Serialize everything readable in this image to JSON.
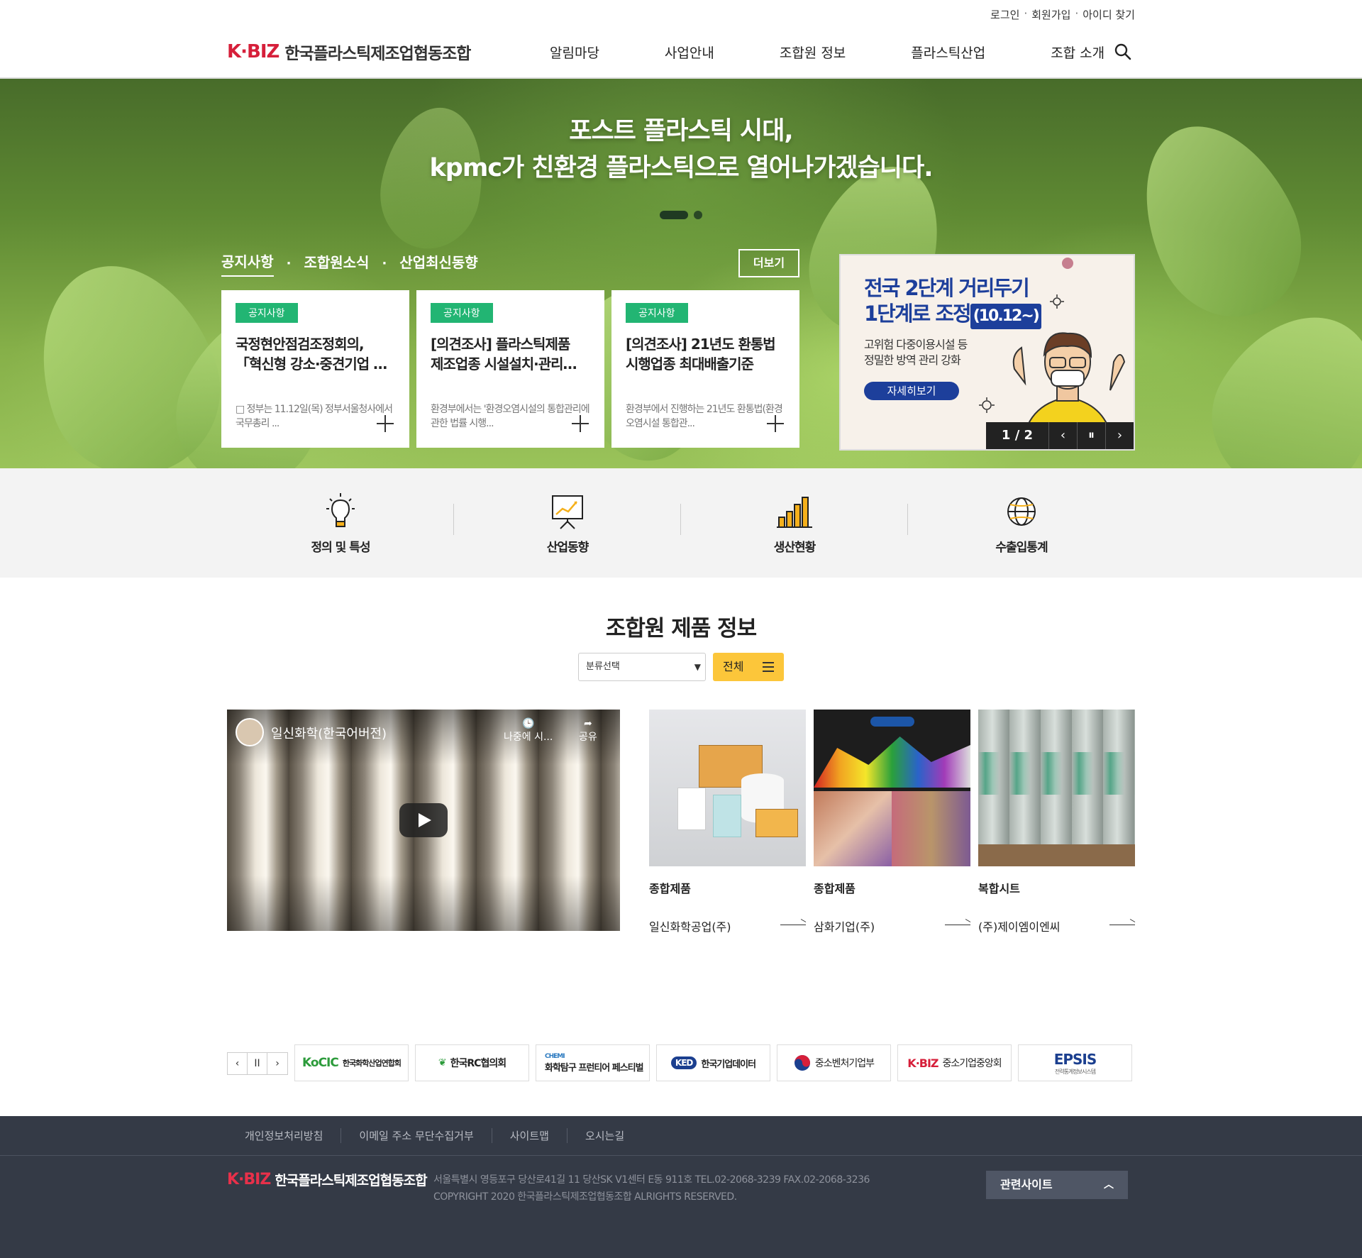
{
  "util": {
    "login": "로그인",
    "join": "회원가입",
    "find_id": "아이디 찾기",
    "sep": "·"
  },
  "header": {
    "logo_mark": "K·BIZ",
    "logo_name": "한국플라스틱제조업협동조합",
    "nav": [
      "알림마당",
      "사업안내",
      "조합원 정보",
      "플라스틱산업",
      "조합 소개"
    ],
    "search_icon": "search-icon"
  },
  "hero": {
    "title_line1": "포스트 플라스틱 시대,",
    "title_line2": "kpmc가 친환경 플라스틱으로 열어나가겠습니다.",
    "tabs": [
      "공지사항",
      "조합원소식",
      "산업최신동향"
    ],
    "tab_sep": "·",
    "more_label": "더보기",
    "cards": [
      {
        "badge": "공지사항",
        "title1": "국정현안점검조정회의,",
        "title2": "「혁신형 강소·중견기업 …",
        "desc": "□ 정부는 11.12일(목) 정부서울청사에서 국무총리 ..."
      },
      {
        "badge": "공지사항",
        "title1": "[의견조사] 플라스틱제품",
        "title2": "제조업종 시설설치·관리…",
        "desc": "환경부에서는 '환경오염시설의 통합관리에 관한 법률 시행..."
      },
      {
        "badge": "공지사항",
        "title1": "[의견조사] 21년도 환통법",
        "title2": "시행업종 최대배출기준",
        "desc": "환경부에서 진행하는 21년도 환통법(환경오염시설 통합관..."
      }
    ],
    "banner": {
      "title1": "전국 2단계 거리두기",
      "title2": "1단계로 조정",
      "date": "(10.12~)",
      "sub1": "고위험 다중이용시설 등",
      "sub2": "정밀한 방역 관리 강화",
      "button": "자세히보기",
      "counter": "1 / 2",
      "prev": "‹",
      "pause": "⏸",
      "next": "›"
    }
  },
  "quick": [
    {
      "label": "정의 및 특성",
      "icon": "lightbulb-icon"
    },
    {
      "label": "산업동향",
      "icon": "presentation-chart-icon"
    },
    {
      "label": "생산현황",
      "icon": "bar-chart-icon"
    },
    {
      "label": "수출입통계",
      "icon": "globe-icon"
    }
  ],
  "products": {
    "title": "조합원 제품 정보",
    "select_label": "분류선택",
    "all_label": "전체",
    "video": {
      "title": "일신화학(한국어버전)",
      "later": "나중에 시...",
      "share": "공유"
    },
    "items": [
      {
        "category": "종합제품",
        "company": "일신화학공업(주)"
      },
      {
        "category": "종합제품",
        "company": "삼화기업(주)"
      },
      {
        "category": "복합시트",
        "company": "(주)제이엠이엔씨"
      }
    ]
  },
  "partners": {
    "controls": [
      "‹",
      "II",
      "›"
    ],
    "items": [
      {
        "name": "한국화학산업연합회",
        "mark": "KoCIC"
      },
      {
        "name": "한국RC협의회",
        "mark": ""
      },
      {
        "name": "화학탐구 프런티어 페스티벌",
        "mark": "CHEMI"
      },
      {
        "name": "한국기업데이터",
        "mark": "KED"
      },
      {
        "name": "중소벤처기업부",
        "mark": ""
      },
      {
        "name": "중소기업중앙회",
        "mark": "K·BIZ"
      },
      {
        "name": "EPSIS",
        "mark": "전력통계정보시스템"
      }
    ]
  },
  "footer": {
    "links": [
      "개인정보처리방침",
      "이메일 주소 무단수집거부",
      "사이트맵",
      "오시는길"
    ],
    "logo_mark": "K·BIZ",
    "logo_name": "한국플라스틱제조업협동조합",
    "address": "서울특별시 영등포구 당산로41길 11 당산SK V1센터 E동 911호 TEL.02-2068-3239 FAX.02-2068-3236",
    "copyright": "COPYRIGHT 2020 한국플라스틱제조업협동조합 ALRIGHTS RESERVED.",
    "related": "관련사이트"
  },
  "colors": {
    "accent_red": "#d61f3a",
    "badge_green": "#22b573",
    "banner_blue": "#1d3f9b",
    "button_yellow": "#fcc63a",
    "footer_bg": "#343a46"
  }
}
